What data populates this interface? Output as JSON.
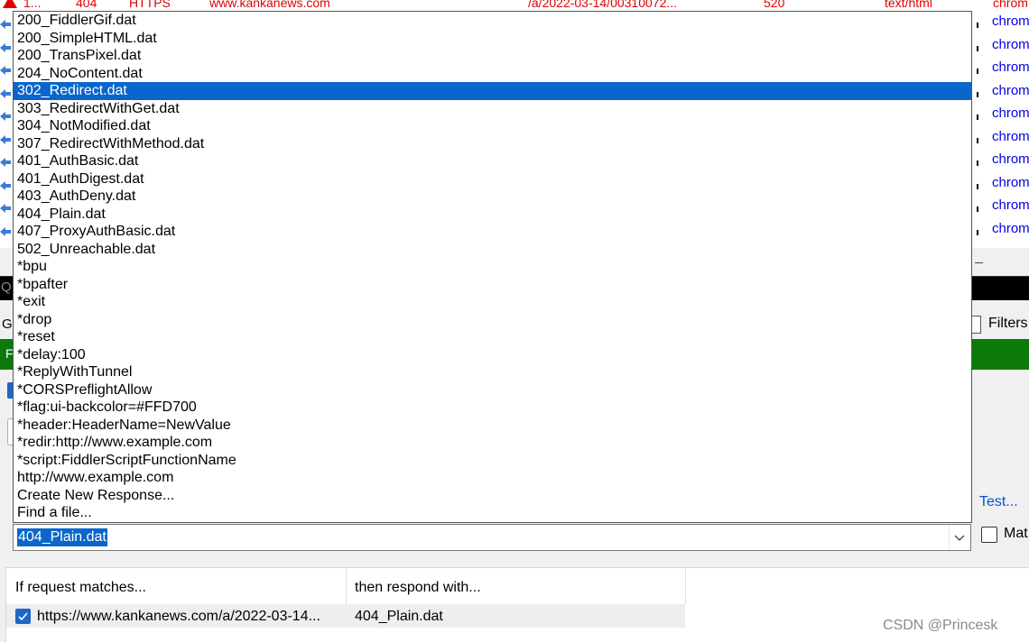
{
  "session_list": {
    "top_row": [
      "1...",
      "404",
      "HTTPS",
      "www.kankanews.com",
      "/a/2022-03-14/00310072...",
      "520",
      "text/html",
      "chrom"
    ],
    "right_process_cells": [
      "chrom",
      "chrom",
      "chrom",
      "chrom",
      "chrom",
      "chrom",
      "chrom",
      "chrom",
      "chrom",
      "chrom"
    ]
  },
  "quickexec": {
    "prefix": "Q"
  },
  "tabs_strip": {
    "left_char": "G",
    "filters_label": "Filters"
  },
  "green_bar": {
    "left_char": "F"
  },
  "autoresponder": {
    "test_link": "Test...",
    "match_label": "Mat",
    "combo_value": "404_Plain.dat",
    "dropdown_options": [
      "200_FiddlerGif.dat",
      "200_SimpleHTML.dat",
      "200_TransPixel.dat",
      "204_NoContent.dat",
      "302_Redirect.dat",
      "303_RedirectWithGet.dat",
      "304_NotModified.dat",
      "307_RedirectWithMethod.dat",
      "401_AuthBasic.dat",
      "401_AuthDigest.dat",
      "403_AuthDeny.dat",
      "404_Plain.dat",
      "407_ProxyAuthBasic.dat",
      "502_Unreachable.dat",
      "*bpu",
      "*bpafter",
      "*exit",
      "*drop",
      "*reset",
      "*delay:100",
      "*ReplyWithTunnel",
      "*CORSPreflightAllow",
      "*flag:ui-backcolor=#FFD700",
      "*header:HeaderName=NewValue",
      "*redir:http://www.example.com",
      "*script:FiddlerScriptFunctionName",
      "http://www.example.com",
      "Create New Response...",
      "Find a file..."
    ],
    "selected_option": "302_Redirect.dat",
    "rules_table": {
      "headers": [
        "If request matches...",
        "then respond with..."
      ],
      "rows": [
        {
          "checked": true,
          "match": "https://www.kankanews.com/a/2022-03-14...",
          "respond": "404_Plain.dat"
        }
      ]
    }
  },
  "watermark": "CSDN @Princesk",
  "colors": {
    "selection": "#0a66cc",
    "green_bar": "#0b7a0b",
    "error_text": "#e00000",
    "process_text": "#0000e0"
  }
}
